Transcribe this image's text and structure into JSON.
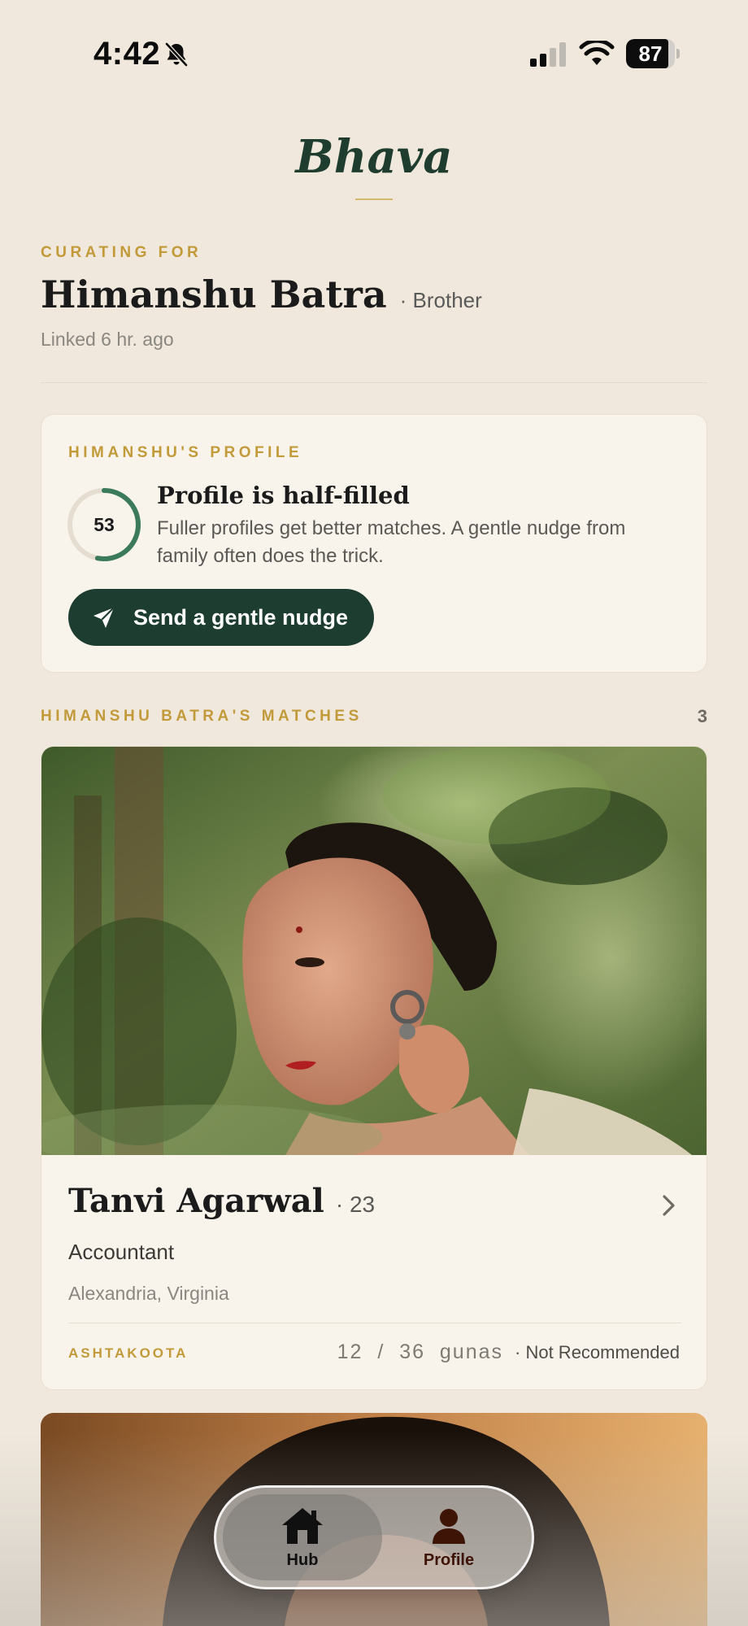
{
  "status_bar": {
    "time": "4:42",
    "battery_level": "87",
    "battery_fraction": 0.87
  },
  "brand": {
    "title": "Bhava"
  },
  "curating": {
    "label": "CURATING FOR",
    "name": "Himanshu Batra",
    "relation": "· Brother",
    "linked": "Linked 6 hr. ago"
  },
  "profile_card": {
    "eyebrow": "HIMANSHU'S PROFILE",
    "progress": "53",
    "progress_fraction": 0.53,
    "title": "Profile is half-filled",
    "description": "Fuller profiles get better matches. A gentle nudge from family often does the trick.",
    "nudge_label": "Send a gentle nudge"
  },
  "matches": {
    "header": "HIMANSHU BATRA'S MATCHES",
    "count": "3",
    "items": [
      {
        "name": "Tanvi Agarwal",
        "age": "· 23",
        "occupation": "Accountant",
        "location": "Alexandria, Virginia",
        "ashtakoota_label": "ASHTAKOOTA",
        "gunas": "12  /  36  gunas",
        "recommendation": "· Not Recommended"
      }
    ]
  },
  "tabs": [
    {
      "label": "Hub",
      "icon": "home-icon"
    },
    {
      "label": "Profile",
      "icon": "person-icon"
    }
  ],
  "colors": {
    "background": "#f0e8dc",
    "brand_green": "#1e3d2f",
    "accent_gold": "#c29a3a",
    "progress_green": "#3b7a5b"
  }
}
